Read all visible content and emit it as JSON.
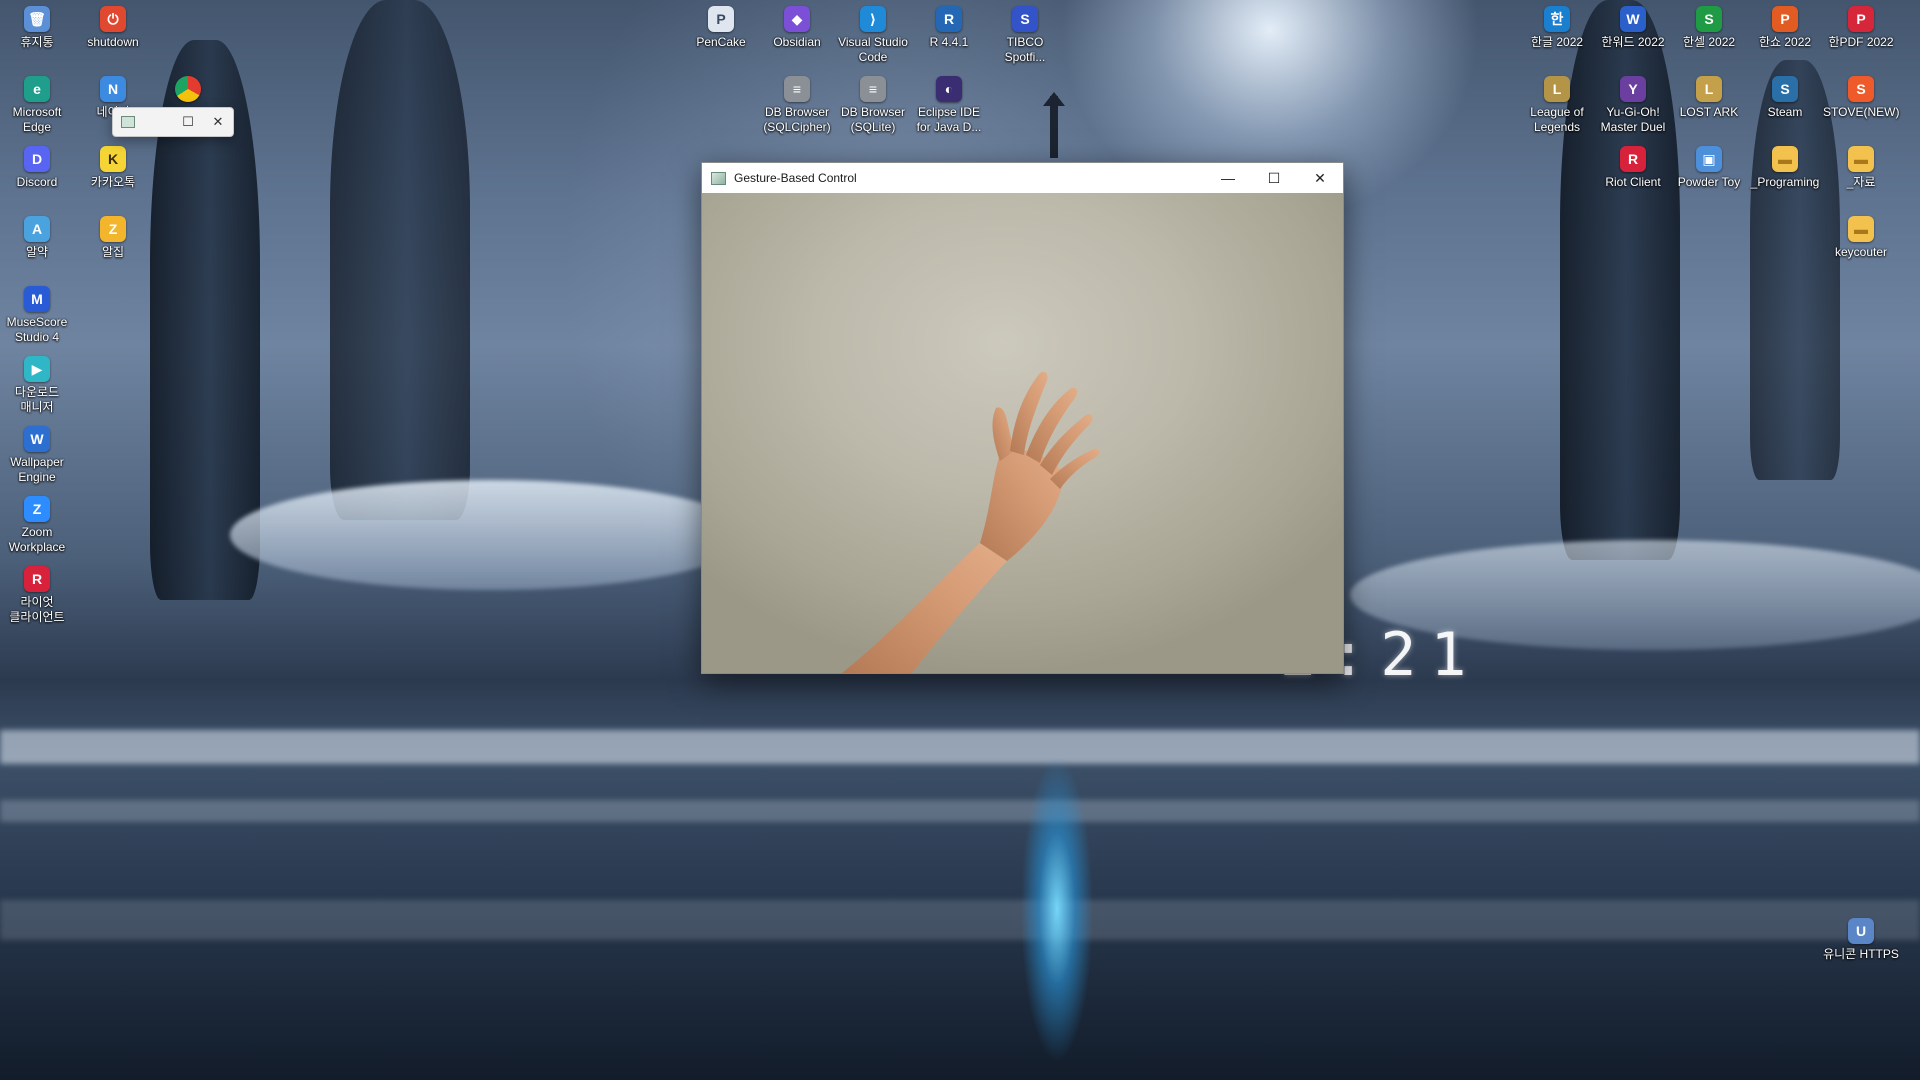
{
  "desktop": {
    "icons_left": [
      {
        "name": "휴지통",
        "color": "#5b8fd6",
        "glyph": "🗑"
      },
      {
        "name": "shutdown",
        "color": "#e0492f",
        "glyph": "⏻"
      },
      {
        "name": "Microsoft Edge",
        "color": "#1f9e8c",
        "glyph": "e"
      },
      {
        "name": "네이버",
        "color": "#3d8be0",
        "glyph": "N"
      },
      {
        "name": "Discord",
        "color": "#5865f2",
        "glyph": "D"
      },
      {
        "name": "카카오톡",
        "color": "#f4d535",
        "glyph": "K"
      },
      {
        "name": "알약",
        "color": "#4aa3df",
        "glyph": "A"
      },
      {
        "name": "알집",
        "color": "#f3b52c",
        "glyph": "Z"
      },
      {
        "name": "MuseScore Studio 4",
        "color": "#2a5bd7",
        "glyph": "M"
      },
      {
        "name": "다운로드 매니저",
        "color": "#2fb7c7",
        "glyph": "▶"
      },
      {
        "name": "Wallpaper Engine",
        "color": "#2c6fd1",
        "glyph": "W"
      },
      {
        "name": "Zoom Workplace",
        "color": "#2d8cff",
        "glyph": "Z"
      },
      {
        "name": "라이엇 클라이언트",
        "color": "#d8213a",
        "glyph": "R"
      }
    ],
    "icons_top_center": [
      {
        "name": "PenCake",
        "color": "#dfe6ef",
        "glyph": "P"
      },
      {
        "name": "Obsidian",
        "color": "#7b4fd6",
        "glyph": "◆"
      },
      {
        "name": "Visual Studio Code",
        "color": "#1f8ad8",
        "glyph": "⟩"
      },
      {
        "name": "R 4.4.1",
        "color": "#2468b5",
        "glyph": "R"
      },
      {
        "name": "TIBCO Spotfi...",
        "color": "#3353c9",
        "glyph": "S"
      },
      {
        "name": "DB Browser (SQLCipher)",
        "color": "#8b8f96",
        "glyph": "≡"
      },
      {
        "name": "DB Browser (SQLite)",
        "color": "#8b8f96",
        "glyph": "≡"
      },
      {
        "name": "Eclipse IDE for Java D...",
        "color": "#3a2d72",
        "glyph": "◐"
      }
    ],
    "icons_right": [
      {
        "name": "한글 2022",
        "color": "#1b7fd0",
        "glyph": "한"
      },
      {
        "name": "한워드 2022",
        "color": "#2b5fc9",
        "glyph": "W"
      },
      {
        "name": "한셀 2022",
        "color": "#1f9a45",
        "glyph": "S"
      },
      {
        "name": "한쇼 2022",
        "color": "#e25b22",
        "glyph": "P"
      },
      {
        "name": "한PDF 2022",
        "color": "#d5263a",
        "glyph": "P"
      },
      {
        "name": "League of Legends",
        "color": "#b49548",
        "glyph": "L"
      },
      {
        "name": "Yu-Gi-Oh! Master Duel",
        "color": "#6a3fa0",
        "glyph": "Y"
      },
      {
        "name": "LOST ARK",
        "color": "#c4a04a",
        "glyph": "L"
      },
      {
        "name": "Steam",
        "color": "#2a6fa8",
        "glyph": "S"
      },
      {
        "name": "STOVE(NEW)",
        "color": "#ef5a2a",
        "glyph": "S"
      },
      {
        "name": "Riot Client",
        "color": "#d8213a",
        "glyph": "R"
      },
      {
        "name": "Powder Toy",
        "color": "#4d8fd9",
        "glyph": "▣"
      },
      {
        "name": "_Programing",
        "color": "#f2c14e",
        "glyph": "▬"
      },
      {
        "name": "_자료",
        "color": "#f2c14e",
        "glyph": "▬"
      },
      {
        "name": "keycouter",
        "color": "#f2c14e",
        "glyph": "▬"
      },
      {
        "name": "유니콘 HTTPS",
        "color": "#5a86c8",
        "glyph": "U"
      }
    ]
  },
  "clock_text": "2:21",
  "main_window": {
    "title": "Gesture-Based Control",
    "minimize": "—",
    "maximize": "☐",
    "close": "✕"
  },
  "mini_window": {
    "maximize": "☐",
    "close": "✕"
  }
}
